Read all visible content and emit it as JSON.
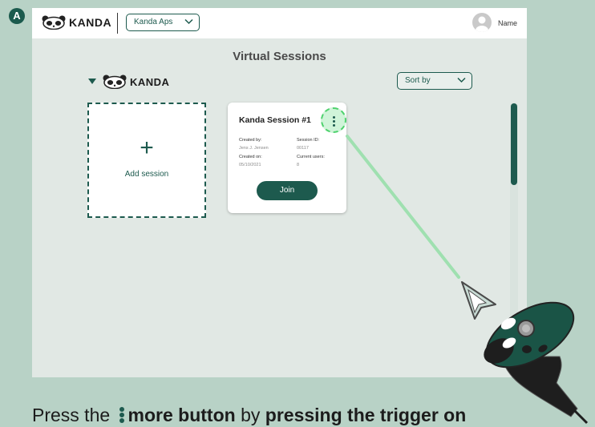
{
  "step_marker": "A",
  "header": {
    "brand": "KANDA",
    "org_selector": {
      "value": "Kanda Aps"
    },
    "user": {
      "name": "Name"
    }
  },
  "page": {
    "title": "Virtual Sessions",
    "group_name": "KANDA",
    "sort": {
      "value": "Sort by"
    }
  },
  "add_session": {
    "label": "Add session"
  },
  "sessions": [
    {
      "title": "Kanda Session #1",
      "created_by_label": "Created by:",
      "created_by": "Jens J. Jensen",
      "created_on_label": "Created on:",
      "created_on": "05/10/2021",
      "session_id_label": "Session ID:",
      "session_id": "00117",
      "current_users_label": "Current users:",
      "current_users": "8",
      "join_label": "Join"
    }
  ],
  "scrollbar": {
    "position": 0.0
  },
  "instruction": {
    "prefix": "Press the",
    "bold1": "more button",
    "middle": "by",
    "bold2": "pressing the trigger on"
  },
  "colors": {
    "accent": "#1d5a4e",
    "highlight": "#4fd26e",
    "background": "#b8d2c6",
    "panel": "#e1e8e4"
  },
  "icons": [
    "panda-logo-icon",
    "chevron-down-icon",
    "user-avatar-icon",
    "caret-down-icon",
    "plus-icon",
    "more-vertical-icon",
    "vr-pointer-cursor-icon",
    "vr-controller-icon"
  ]
}
